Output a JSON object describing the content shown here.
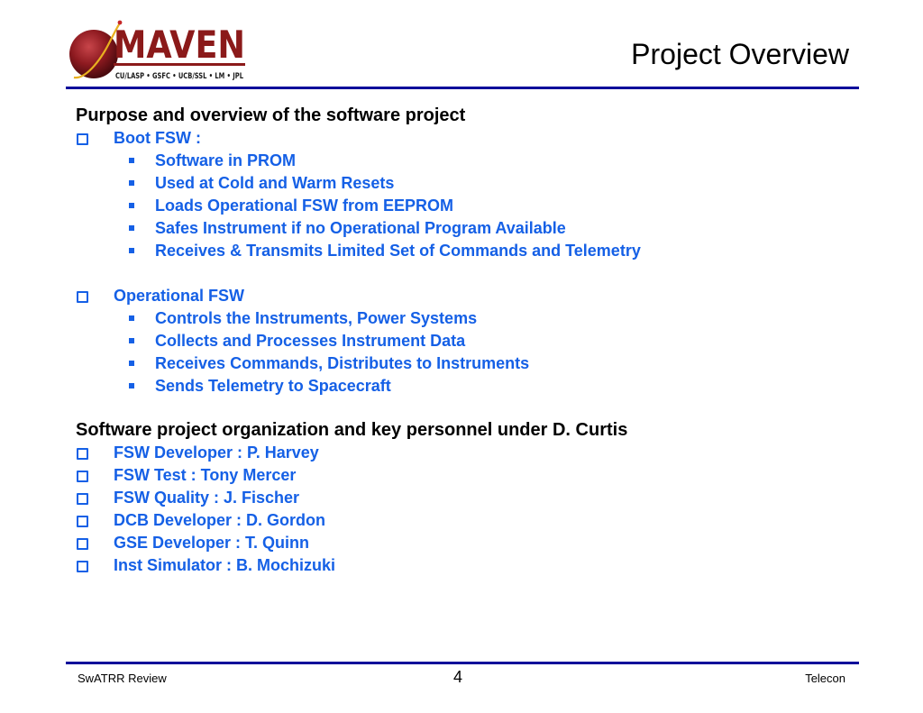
{
  "header": {
    "logo": {
      "name": "MAVEN",
      "partners": "CU/LASP • GSFC • UCB/SSL • LM • JPL",
      "colors": {
        "wordmark": "#8b1a1a",
        "planet": "#9c1c22",
        "orbit": "#e8b020",
        "partners_text": "#1a1a1a"
      }
    },
    "title": "Project Overview"
  },
  "colors": {
    "rule": "#0a0a9a",
    "heading": "#000000",
    "bullet_text": "#1560e6"
  },
  "sections": [
    {
      "heading": "Purpose and overview of the software project",
      "groups": [
        {
          "label": "Boot FSW :",
          "bullet_icon": "hollow-square",
          "items": [
            "Software in PROM",
            "Used at Cold and Warm Resets",
            "Loads Operational FSW from EEPROM",
            "Safes Instrument if no Operational Program Available",
            "Receives & Transmits Limited Set of Commands and Telemetry"
          ]
        },
        {
          "label": "Operational FSW",
          "bullet_icon": "hollow-square",
          "items": [
            "Controls the Instruments, Power Systems",
            "Collects and Processes Instrument Data",
            "Receives Commands, Distributes to Instruments",
            "Sends Telemetry to Spacecraft"
          ]
        }
      ]
    },
    {
      "heading": "Software project organization and key personnel under D. Curtis",
      "personnel": [
        "FSW Developer :  P. Harvey",
        "FSW Test : Tony Mercer",
        "FSW Quality :  J. Fischer",
        "DCB Developer : D. Gordon",
        "GSE Developer : T. Quinn",
        "Inst Simulator : B. Mochizuki"
      ]
    }
  ],
  "footer": {
    "left": "SwATRR Review",
    "page_number": "4",
    "right": "Telecon"
  }
}
